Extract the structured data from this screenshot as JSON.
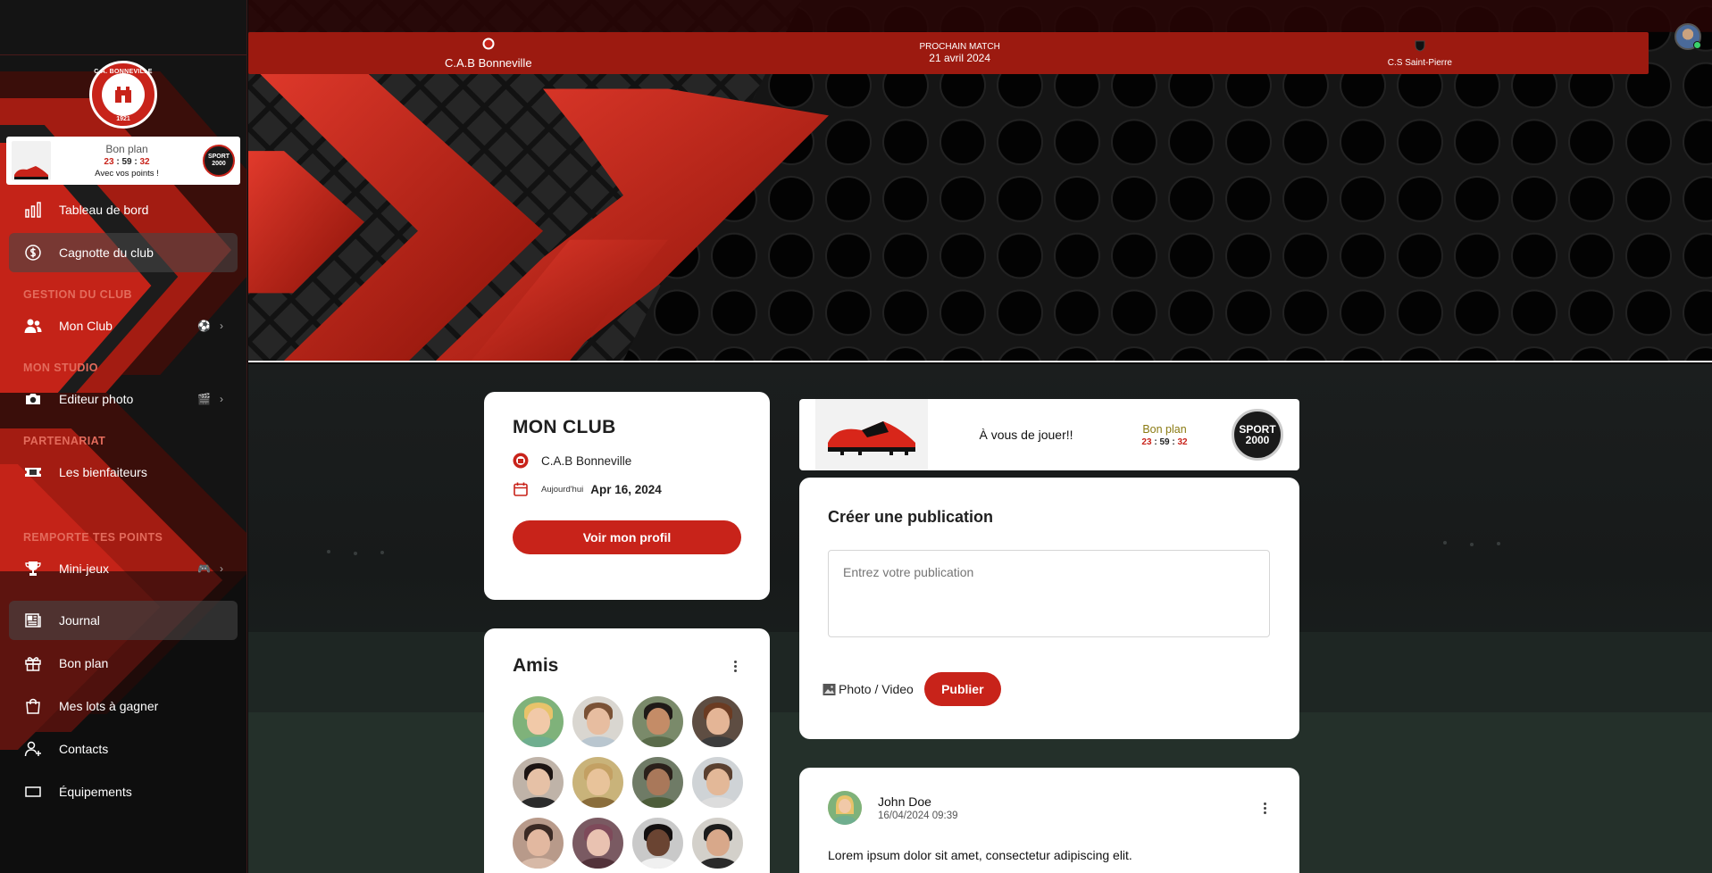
{
  "club_logo": {
    "top_text": "C.A. BONNEVILLE",
    "year": "1921"
  },
  "sidebar_bonplan": {
    "title": "Bon plan",
    "h": "23",
    "m": "59",
    "s": "32",
    "sub": "Avec vos points !",
    "sponsor_l1": "SPORT",
    "sponsor_l2": "2000"
  },
  "nav": {
    "dashboard": "Tableau de bord",
    "cagnotte": "Cagnotte du club",
    "section_gestion": "GESTION DU CLUB",
    "mon_club": "Mon Club",
    "section_studio": "MON STUDIO",
    "editeur": "Editeur photo",
    "section_partenariat": "PARTENARIAT",
    "bienfaiteurs": "Les bienfaiteurs",
    "section_points": "REMPORTE TES POINTS",
    "minijeux": "Mini-jeux",
    "journal": "Journal",
    "bonplan": "Bon plan",
    "lots": "Mes lots à gagner",
    "contacts": "Contacts",
    "equipements": "Équipements"
  },
  "match": {
    "home": "C.A.B Bonneville",
    "label": "PROCHAIN MATCH",
    "date": "21 avril 2024",
    "away": "C.S Saint-Pierre"
  },
  "club_card": {
    "title": "MON CLUB",
    "club_name": "C.A.B Bonneville",
    "today_label": "Aujourd'hui",
    "today_date": "Apr 16, 2024",
    "profile_button": "Voir mon profil"
  },
  "friends": {
    "title": "Amis",
    "list": [
      {
        "skin": "#f1c9a8",
        "hair": "#e8c36a",
        "body": "#6fae8f",
        "bg": "#7fb27a"
      },
      {
        "skin": "#e7bda0",
        "hair": "#7a5236",
        "body": "#b9c6cf",
        "bg": "#d9d6d0"
      },
      {
        "skin": "#c48c67",
        "hair": "#1f1a17",
        "body": "#5a6b4a",
        "bg": "#7a8a6a"
      },
      {
        "skin": "#e4b596",
        "hair": "#6b3b22",
        "body": "#3c3c3c",
        "bg": "#5e4d42"
      },
      {
        "skin": "#e6c1a6",
        "hair": "#1c1412",
        "body": "#2b2b2b",
        "bg": "#bfb3a8"
      },
      {
        "skin": "#e8c39a",
        "hair": "#c3a063",
        "body": "#8a6d3b",
        "bg": "#c9b37a"
      },
      {
        "skin": "#a9785a",
        "hair": "#2a201a",
        "body": "#4d5d3a",
        "bg": "#6f7b66"
      },
      {
        "skin": "#e3b898",
        "hair": "#5a4030",
        "body": "#dcdcdc",
        "bg": "#cfd3d6"
      },
      {
        "skin": "#e2b8a0",
        "hair": "#3b2a24",
        "body": "#d7b9a7",
        "bg": "#b89a8a"
      },
      {
        "skin": "#e9c2b1",
        "hair": "#7e4a5a",
        "body": "#52323a",
        "bg": "#7a5a62"
      },
      {
        "skin": "#6a4432",
        "hair": "#141010",
        "body": "#f0f0f0",
        "bg": "#c9c9c9"
      },
      {
        "skin": "#d8a88a",
        "hair": "#1c1c1c",
        "body": "#2a2a2a",
        "bg": "#d3d0ca"
      }
    ]
  },
  "promo": {
    "text": "À vous de jouer!!",
    "label": "Bon plan",
    "h": "23",
    "m": "59",
    "s": "32",
    "sponsor_l1": "SPORT",
    "sponsor_l2": "2000"
  },
  "post": {
    "title": "Créer une publication",
    "placeholder": "Entrez votre publication",
    "photo_label": "Photo / Video",
    "publish_label": "Publier"
  },
  "feed": {
    "author": "John Doe",
    "datetime": "16/04/2024 09:39",
    "text": "Lorem ipsum dolor sit amet, consectetur adipiscing elit."
  },
  "colors": {
    "accent": "#c8231a",
    "section": "#e36b5c",
    "matchbar": "#9c1a10"
  }
}
